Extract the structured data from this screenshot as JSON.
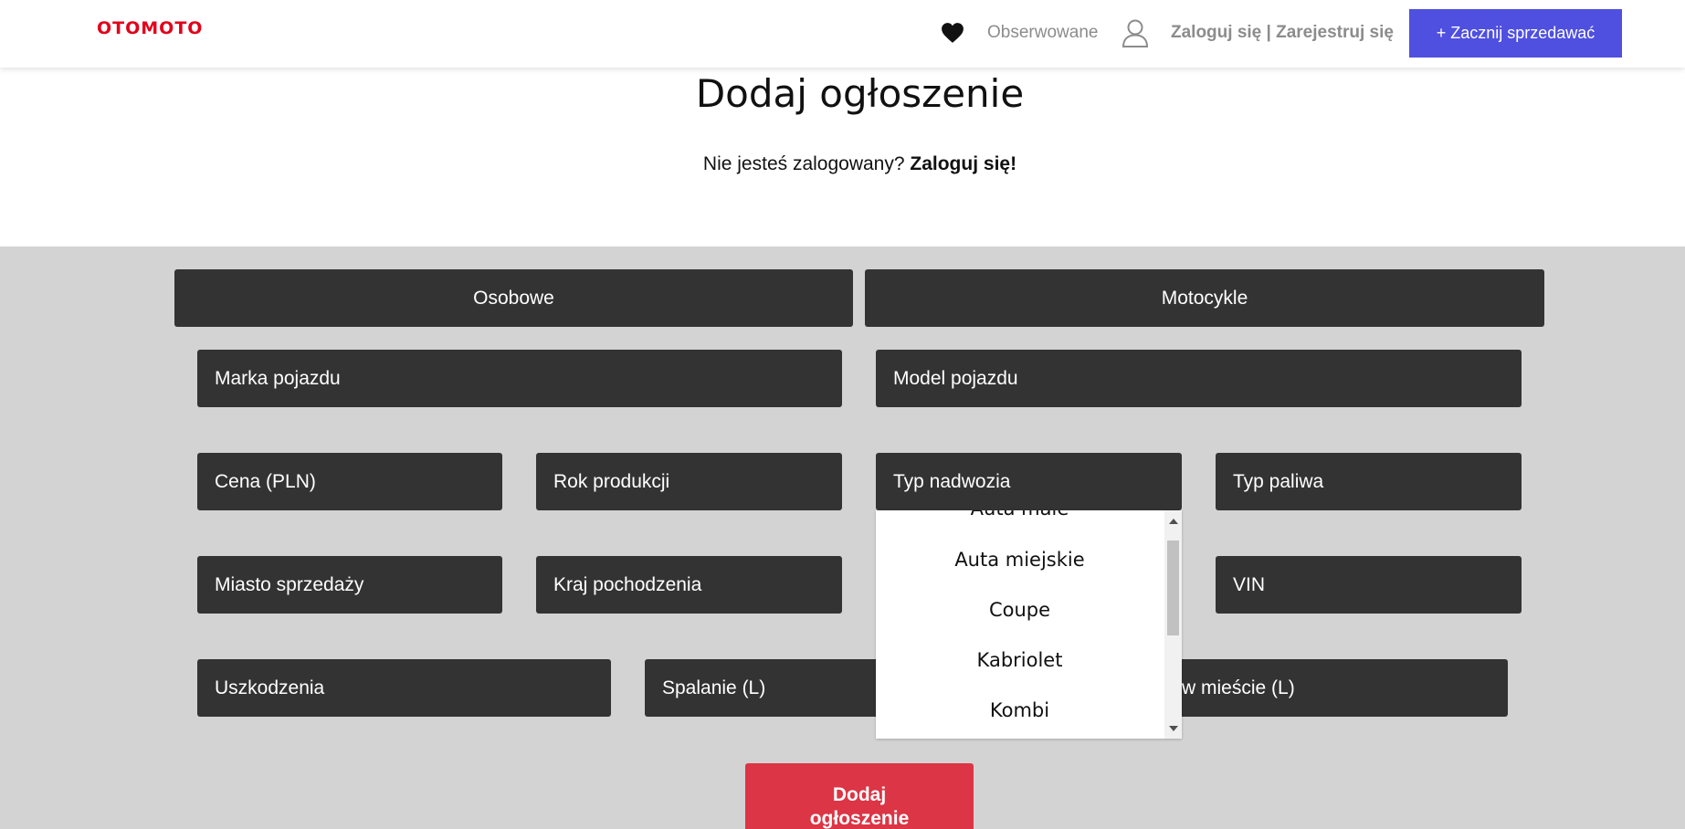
{
  "header": {
    "logo_text": "OTOMOTO",
    "watch_label": "Obserwowane",
    "login_label": "Zaloguj się | Zarejestruj się",
    "sell_label": "+ Zacznij sprzedawać",
    "brand_color": "#e2001a",
    "accent_color": "#4f4fe0"
  },
  "hero": {
    "title": "Dodaj ogłoszenie",
    "subtitle_prefix": "Nie jesteś zalogowany? ",
    "subtitle_link": "Zaloguj się!"
  },
  "categories": [
    "Osobowe",
    "Motocykle"
  ],
  "fields": {
    "brand": "Marka pojazdu",
    "model": "Model pojazdu",
    "price": "Cena (PLN)",
    "year": "Rok produkcji",
    "body_type": "Typ nadwozia",
    "fuel": "Typ paliwa",
    "city": "Miasto sprzedaży",
    "country": "Kraj pochodzenia",
    "vin": "VIN",
    "damage": "Uszkodzenia",
    "consumption": "Spalanie (L)",
    "consumption_city_partial": "w mieście (L)"
  },
  "body_type_dropdown": {
    "options": [
      "Auta małe",
      "Auta miejskie",
      "Coupe",
      "Kabriolet",
      "Kombi"
    ]
  },
  "submit": {
    "line1": "Dodaj",
    "line2": "ogłoszenie",
    "color": "#dc3545"
  }
}
